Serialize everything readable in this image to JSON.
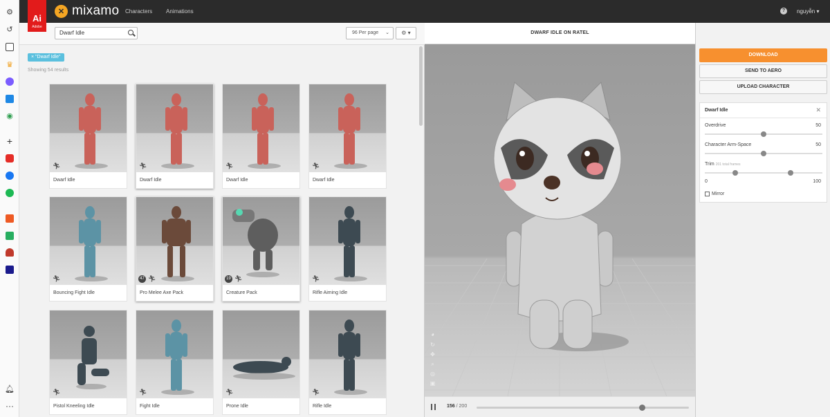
{
  "topbar": {
    "adobe_logo": "Ai",
    "adobe_text": "Adobe",
    "brand_name": "mixamo",
    "nav": [
      "Characters",
      "Animations"
    ],
    "help_icon": "?",
    "user_name": "nguyễn ▾"
  },
  "browse": {
    "search_value": "Dwarf Idle",
    "per_page": "96 Per page",
    "settings_icon": "⚙ ▾",
    "filter_tag": "× \"Dwarf Idle\"",
    "results_text": "Showing 54 results",
    "cards": [
      {
        "label": "Dwarf Idle",
        "badge": ""
      },
      {
        "label": "Dwarf Idle",
        "badge": ""
      },
      {
        "label": "Dwarf Idle",
        "badge": ""
      },
      {
        "label": "Dwarf Idle",
        "badge": ""
      },
      {
        "label": "Bouncing Fight Idle",
        "badge": ""
      },
      {
        "label": "Pro Melee Axe Pack",
        "badge": "47"
      },
      {
        "label": "Creature Pack",
        "badge": "19"
      },
      {
        "label": "Rifle Aiming Idle",
        "badge": ""
      },
      {
        "label": "Pistol Kneeling Idle",
        "badge": ""
      },
      {
        "label": "Fight Idle",
        "badge": ""
      },
      {
        "label": "Prone Idle",
        "badge": ""
      },
      {
        "label": "Rifle Idle",
        "badge": ""
      }
    ]
  },
  "viewport": {
    "title": "DWARF IDLE ON RATEL",
    "current_frame": "156",
    "total_frames": "/ 200",
    "timeline_progress": 0.78
  },
  "panel": {
    "download": "DOWNLOAD",
    "send_to_aero": "SEND TO AERO",
    "upload_character": "UPLOAD CHARACTER",
    "settings_title": "Dwarf Idle",
    "close_icon": "✕",
    "overdrive_label": "Overdrive",
    "overdrive_value": "50",
    "armspace_label": "Character Arm-Space",
    "armspace_value": "50",
    "trim_label": "Trim",
    "trim_note": "201 total frames",
    "trim_min": "0",
    "trim_max": "100",
    "mirror_label": "Mirror"
  },
  "colors": {
    "accent": "#f7902f",
    "topbar": "#2b2b2b",
    "adobe_red": "#e21b1b",
    "tag": "#5bc0de"
  }
}
